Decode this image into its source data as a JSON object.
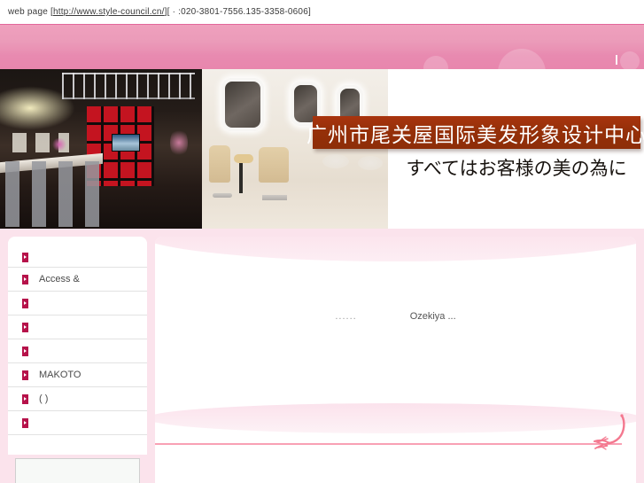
{
  "topbar": {
    "label": "web page",
    "bracket_open": "[",
    "url": "http://www.style-council.cn/",
    "bracket_close": "][",
    "middot": "·",
    "phone": ":020-3801-7556.135-3358-0606]"
  },
  "search": {
    "value": "",
    "placeholder": "",
    "button_label": ""
  },
  "banner": {
    "title_cn": "广州市尾关屋国际美发形象设计中心",
    "subtitle_ja": "すべてはお客様の美の為に",
    "photo_one_alt": "salon-interior-dark",
    "photo_two_alt": "salon-interior-bright"
  },
  "sidebar": {
    "items": [
      {
        "label": "",
        "icon": "arrow-bullet-icon"
      },
      {
        "label": "Access &",
        "icon": "arrow-bullet-icon"
      },
      {
        "label": "",
        "icon": "arrow-bullet-icon"
      },
      {
        "label": "",
        "icon": "arrow-bullet-icon"
      },
      {
        "label": "",
        "icon": "arrow-bullet-icon"
      },
      {
        "label": "MAKOTO",
        "icon": "arrow-bullet-icon"
      },
      {
        "label": "  ( )",
        "icon": "arrow-bullet-icon"
      },
      {
        "label": "",
        "icon": "arrow-bullet-icon"
      }
    ]
  },
  "content": {
    "dots": "......",
    "headline": "Ozekiya ...",
    "footnote": ""
  },
  "colors": {
    "pink_banner": "#e88ab0",
    "page_pink": "#fbe3ec",
    "plate_red": "#963009",
    "bullet_red": "#b6124a",
    "rule_pink": "#f8a0b4"
  }
}
